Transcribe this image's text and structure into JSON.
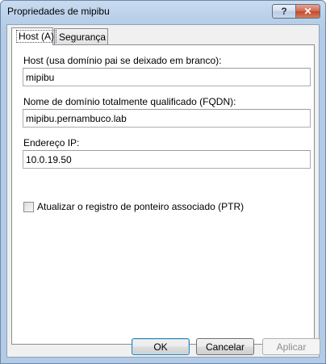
{
  "window": {
    "title": "Propriedades de mipibu",
    "help_glyph": "?",
    "close_glyph": "✕"
  },
  "tabs": [
    {
      "label": "Host (A)",
      "active": true
    },
    {
      "label": "Segurança",
      "active": false
    }
  ],
  "form": {
    "host_label": "Host (usa domínio pai se deixado em branco):",
    "host_value": "mipibu",
    "fqdn_label": "Nome de domínio totalmente qualificado (FQDN):",
    "fqdn_value": "mipibu.pernambuco.lab",
    "ip_label": "Endereço IP:",
    "ip_value": "10.0.19.50",
    "ptr_label": "Atualizar o registro de ponteiro associado (PTR)",
    "ptr_checked": false
  },
  "buttons": {
    "ok": "OK",
    "cancel": "Cancelar",
    "apply": "Aplicar"
  }
}
